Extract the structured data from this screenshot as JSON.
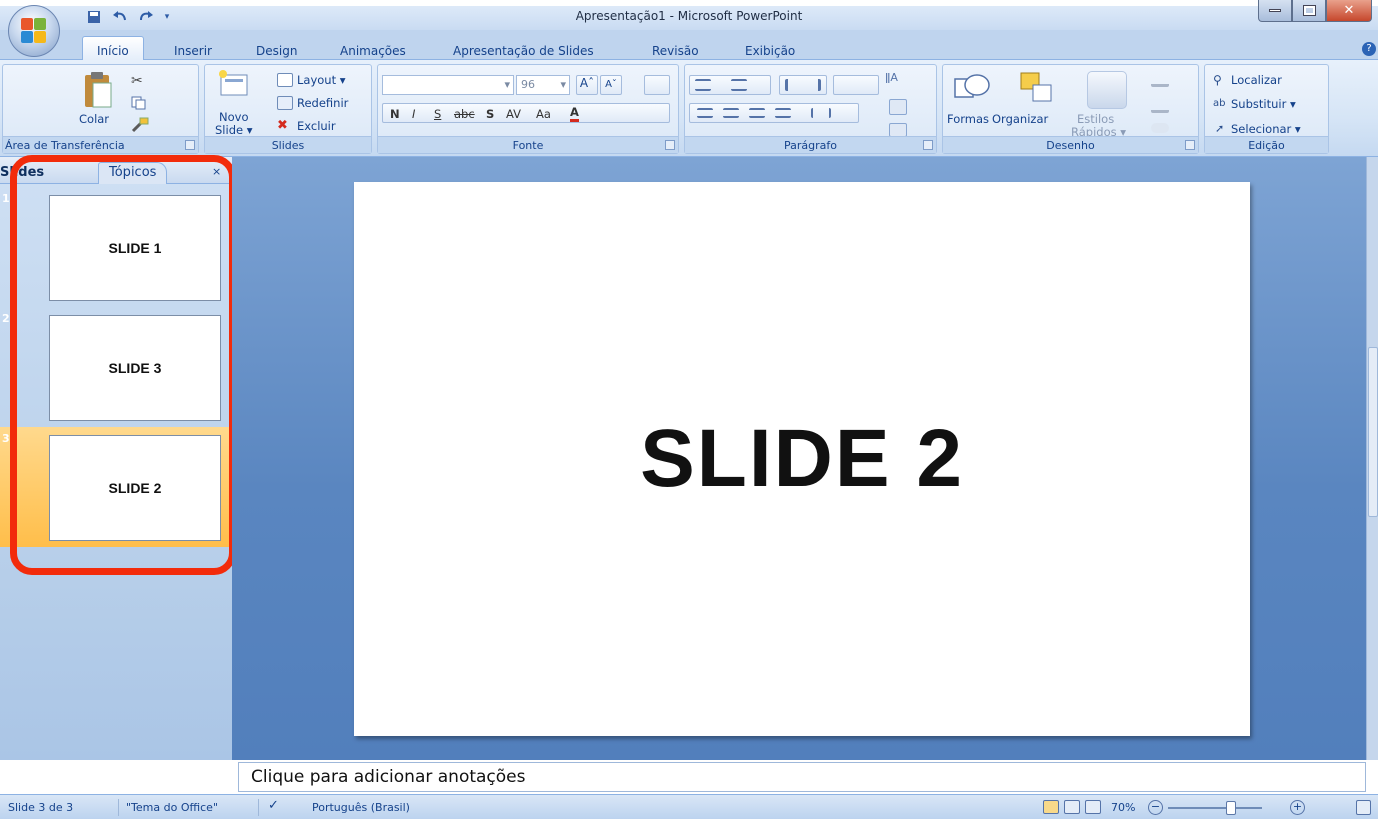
{
  "window": {
    "title": "Apresentação1 - Microsoft PowerPoint"
  },
  "tabs": [
    "Início",
    "Inserir",
    "Design",
    "Animações",
    "Apresentação de Slides",
    "Revisão",
    "Exibição"
  ],
  "ribbon": {
    "clipboard": {
      "paste": "Colar",
      "label": "Área de Transferência"
    },
    "slides": {
      "new_line1": "Novo",
      "new_line2": "Slide ▾",
      "layout": "Layout ▾",
      "reset": "Redefinir",
      "delete": "Excluir",
      "label": "Slides"
    },
    "font": {
      "size": "96",
      "label": "Fonte"
    },
    "paragraph": {
      "label": "Parágrafo"
    },
    "drawing": {
      "shapes": "Formas",
      "arrange": "Organizar",
      "styles_line1": "Estilos",
      "styles_line2": "Rápidos ▾",
      "label": "Desenho"
    },
    "editing": {
      "find": "Localizar",
      "replace": "Substituir ▾",
      "select": "Selecionar ▾",
      "label": "Edição"
    }
  },
  "left_pane": {
    "tabs": [
      "Slides",
      "Tópicos"
    ],
    "thumbnails": [
      {
        "num": "1",
        "title": "SLIDE 1"
      },
      {
        "num": "2",
        "title": "SLIDE 3"
      },
      {
        "num": "3",
        "title": "SLIDE 2"
      }
    ]
  },
  "slide": {
    "title": "SLIDE 2"
  },
  "notes": {
    "placeholder": "Clique para adicionar anotações"
  },
  "status": {
    "slide": "Slide 3 de 3",
    "theme": "\"Tema do Office\"",
    "language": "Português (Brasil)",
    "zoom": "70%"
  },
  "colors": {
    "accent": "#15428b",
    "highlight": "#f22b0b",
    "selected_thumb": "#ffbe4a"
  }
}
